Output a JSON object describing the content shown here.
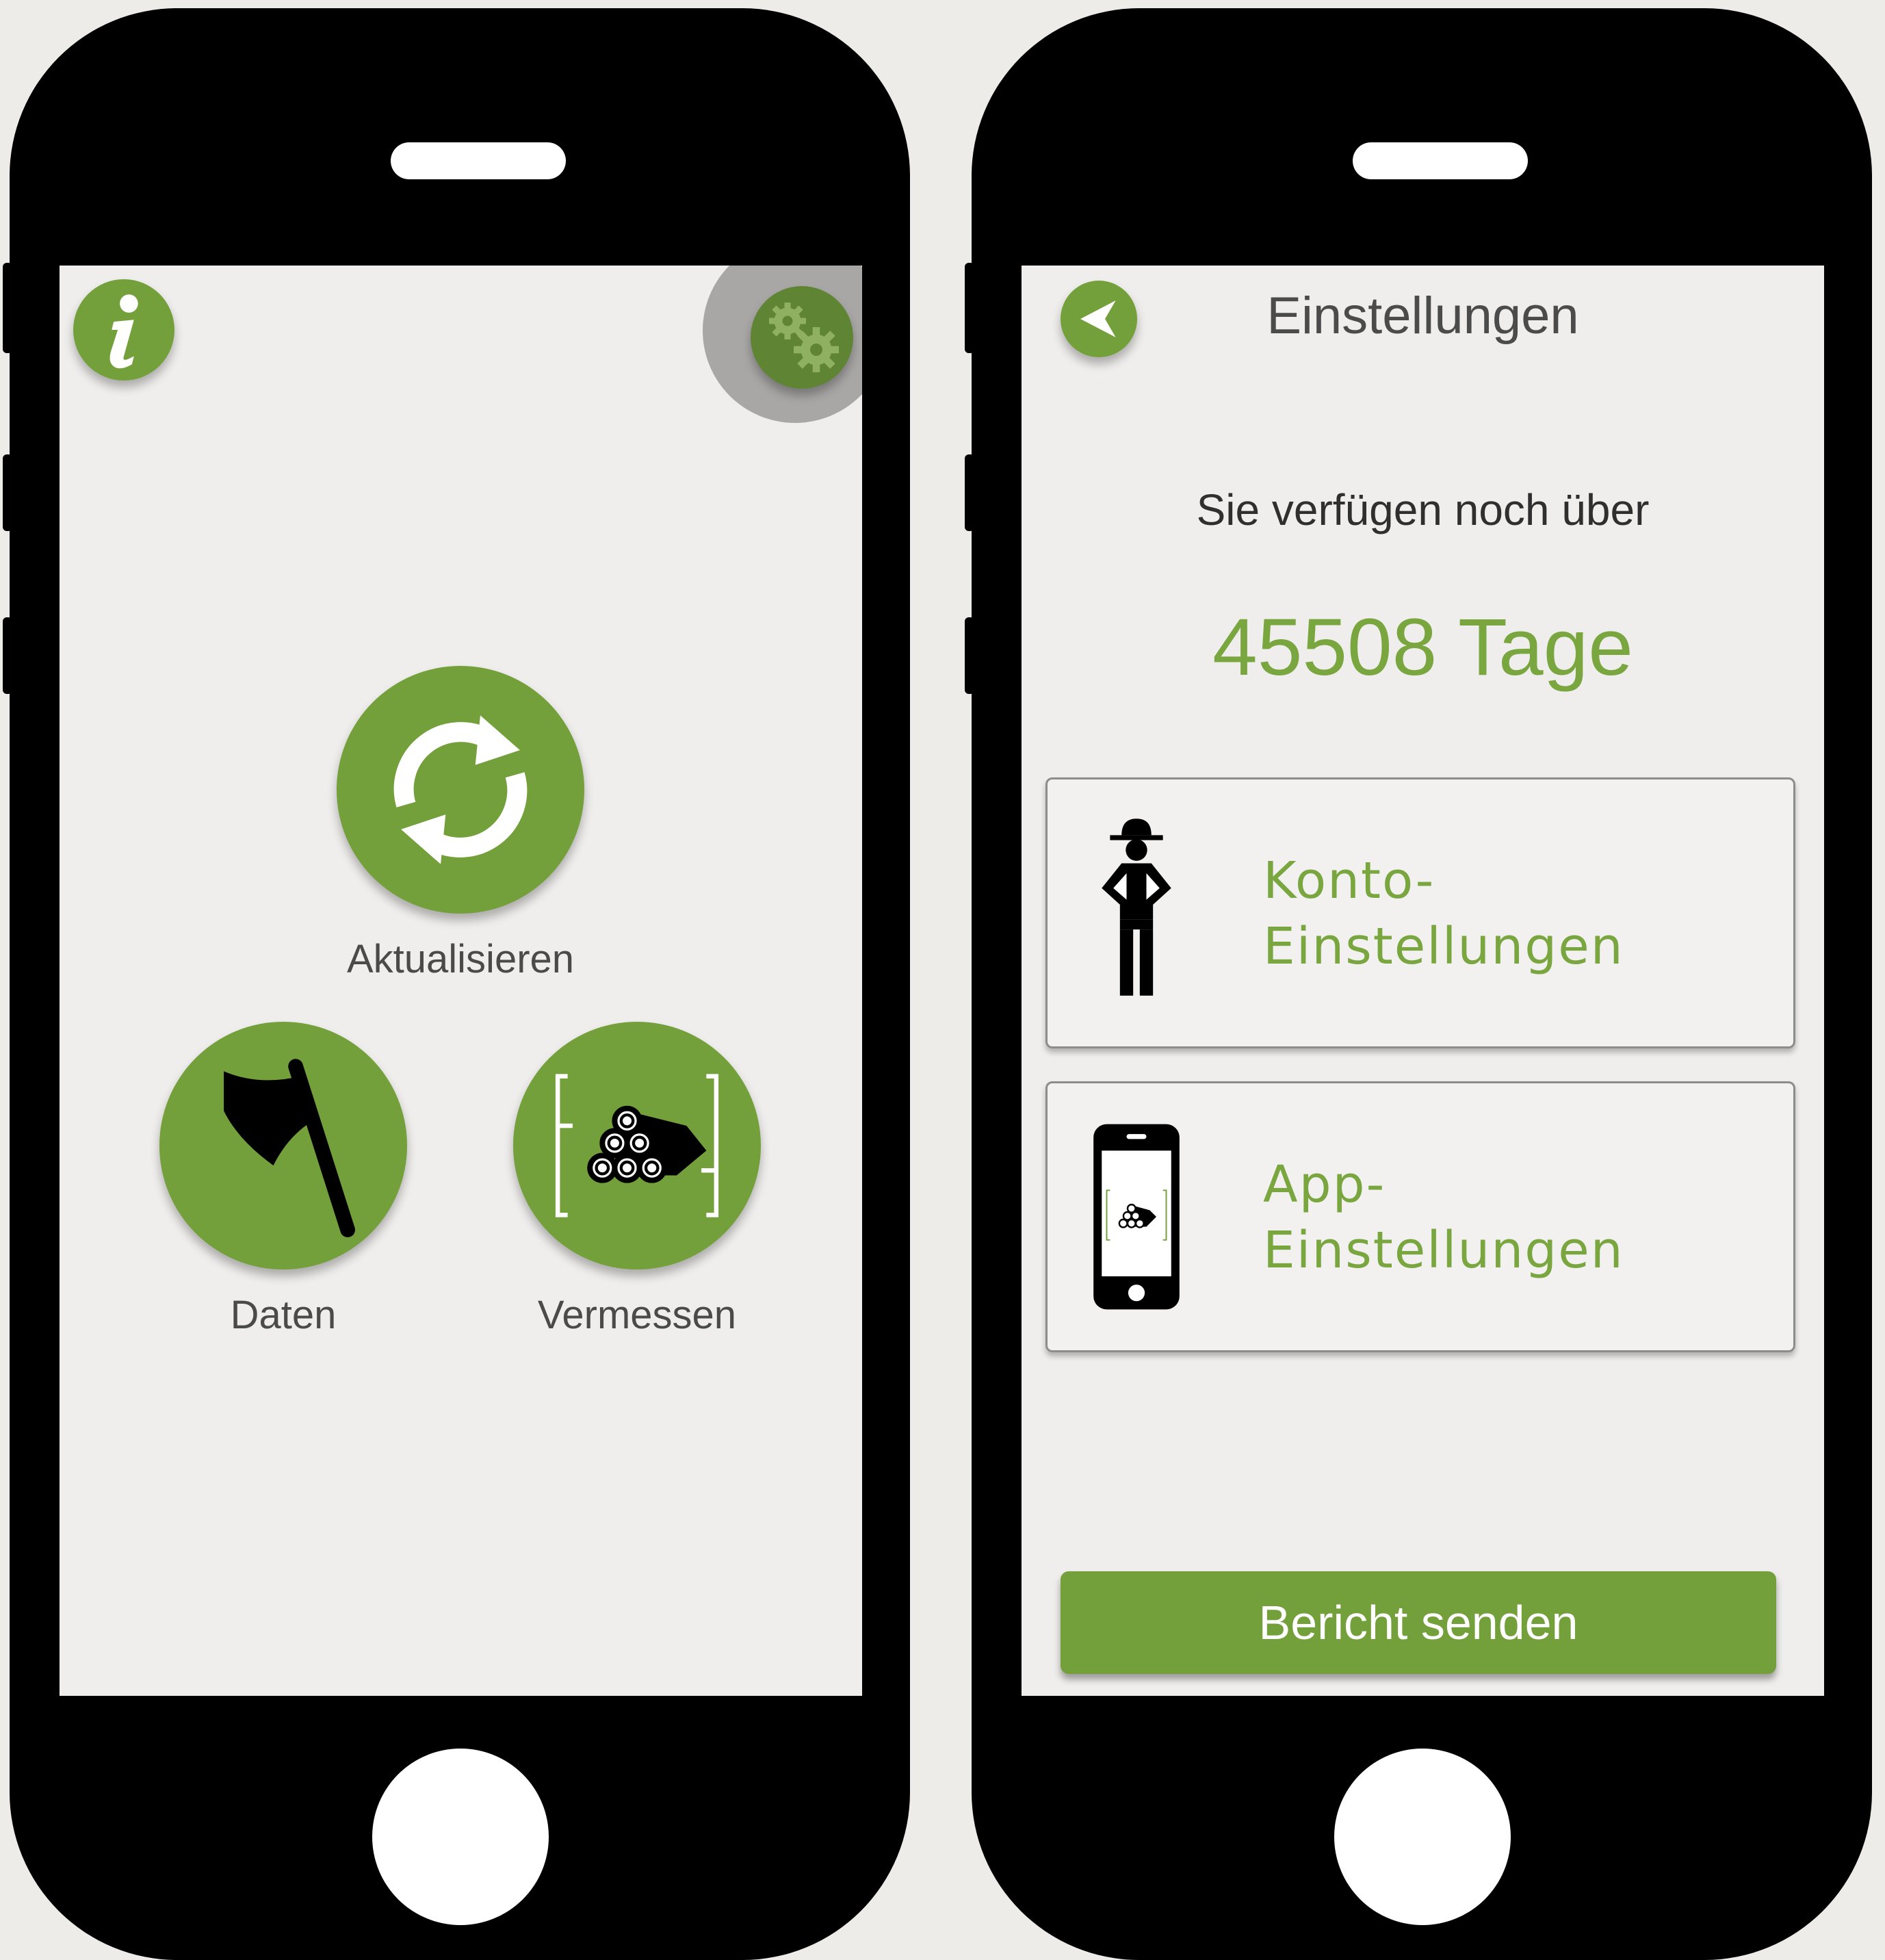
{
  "accent_color": "#73a03a",
  "home_screen": {
    "info_icon": "info-icon",
    "settings_icon": "gears-icon",
    "buttons": [
      {
        "label": "Aktualisieren",
        "icon": "refresh-icon"
      },
      {
        "label": "Daten",
        "icon": "axe-icon"
      },
      {
        "label": "Vermessen",
        "icon": "log-stack-icon"
      }
    ]
  },
  "settings_screen": {
    "title": "Einstellungen",
    "back_icon": "back-arrow-icon",
    "remaining_text": "Sie verfügen noch über",
    "remaining_days": "45508 Tage",
    "cards": [
      {
        "line1": "Konto-",
        "line2": "Einstellungen",
        "icon": "ranger-figure-icon"
      },
      {
        "line1": "App-",
        "line2": "Einstellungen",
        "icon": "phone-icon"
      }
    ],
    "send_button": "Bericht senden"
  }
}
